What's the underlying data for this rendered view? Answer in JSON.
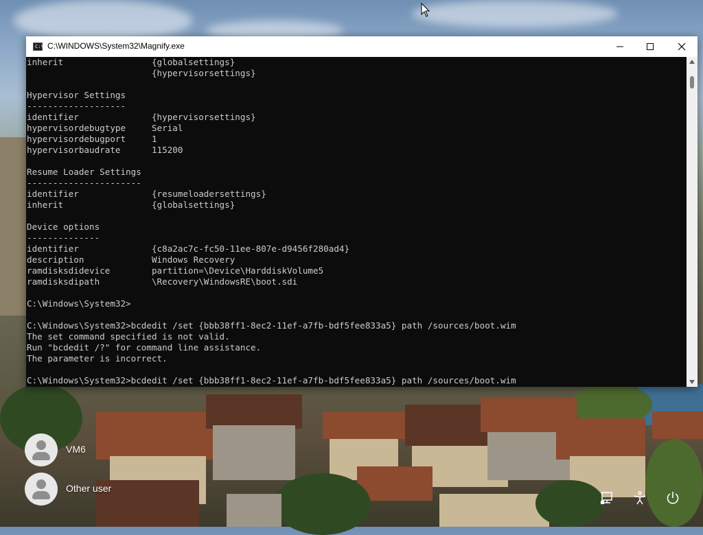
{
  "window": {
    "title": "C:\\WINDOWS\\System32\\Magnify.exe",
    "icon": "console-icon",
    "icon_text": "C:\\",
    "controls": [
      "minimize-icon",
      "maximize-icon",
      "close-icon"
    ]
  },
  "console": {
    "lines": [
      "inherit                 {globalsettings}",
      "                        {hypervisorsettings}",
      "",
      "Hypervisor Settings",
      "-------------------",
      "identifier              {hypervisorsettings}",
      "hypervisordebugtype     Serial",
      "hypervisordebugport     1",
      "hypervisorbaudrate      115200",
      "",
      "Resume Loader Settings",
      "----------------------",
      "identifier              {resumeloadersettings}",
      "inherit                 {globalsettings}",
      "",
      "Device options",
      "--------------",
      "identifier              {c8a2ac7c-fc50-11ee-807e-d9456f280ad4}",
      "description             Windows Recovery",
      "ramdisksdidevice        partition=\\Device\\HarddiskVolume5",
      "ramdisksdipath          \\Recovery\\WindowsRE\\boot.sdi",
      "",
      "C:\\Windows\\System32>",
      "",
      "C:\\Windows\\System32>bcdedit /set {bbb38ff1-8ec2-11ef-a7fb-bdf5fee833a5} path /sources/boot.wim",
      "The set command specified is not valid.",
      "Run \"bcdedit /?\" for command line assistance.",
      "The parameter is incorrect.",
      "",
      "C:\\Windows\\System32>bcdedit /set {bbb38ff1-8ec2-11ef-a7fb-bdf5fee833a5} path /sources/boot.wim"
    ]
  },
  "users": [
    {
      "name": "VM6"
    },
    {
      "name": "Other user"
    }
  ],
  "tray": [
    "network-icon",
    "accessibility-icon",
    "power-icon"
  ],
  "colors": {
    "console_bg": "#0c0c0c",
    "console_fg": "#cccccc",
    "titlebar_bg": "#ffffff"
  }
}
